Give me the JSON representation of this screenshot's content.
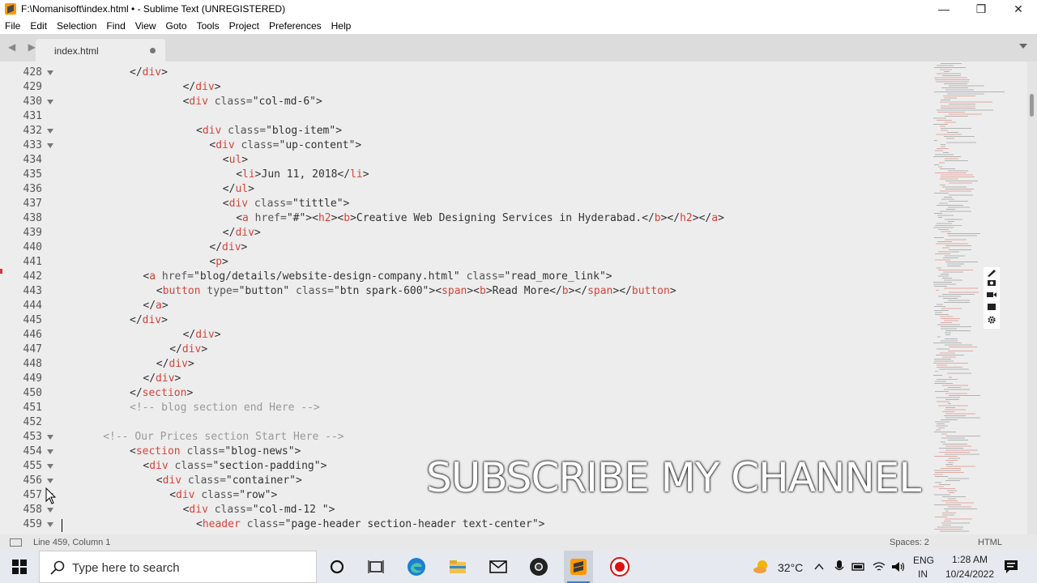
{
  "window": {
    "title": "F:\\Nomanisoft\\index.html • - Sublime Text (UNREGISTERED)",
    "minimize": "—",
    "maximize": "❐",
    "close": "✕"
  },
  "menu": [
    "File",
    "Edit",
    "Selection",
    "Find",
    "View",
    "Goto",
    "Tools",
    "Project",
    "Preferences",
    "Help"
  ],
  "tab": {
    "label": "index.html",
    "modified": true
  },
  "nav_arrows": "◀ ▶",
  "editor": {
    "lines": [
      {
        "n": "428",
        "fold": true,
        "indent": 10,
        "tokens": [
          [
            "p",
            "</"
          ],
          [
            "t",
            "div"
          ],
          [
            "p",
            ">"
          ]
        ]
      },
      {
        "n": "429",
        "fold": false,
        "indent": 18,
        "tokens": [
          [
            "p",
            "</"
          ],
          [
            "t",
            "div"
          ],
          [
            "p",
            ">"
          ]
        ]
      },
      {
        "n": "430",
        "fold": true,
        "indent": 18,
        "tokens": [
          [
            "p",
            "<"
          ],
          [
            "t",
            "div"
          ],
          [
            "a",
            " class="
          ],
          [
            "v",
            "\"col-md-6\""
          ],
          [
            "p",
            ">"
          ]
        ]
      },
      {
        "n": "431",
        "fold": false,
        "indent": 0,
        "tokens": []
      },
      {
        "n": "432",
        "fold": true,
        "indent": 20,
        "tokens": [
          [
            "p",
            "<"
          ],
          [
            "t",
            "div"
          ],
          [
            "a",
            " class="
          ],
          [
            "v",
            "\"blog-item\""
          ],
          [
            "p",
            ">"
          ]
        ]
      },
      {
        "n": "433",
        "fold": true,
        "indent": 22,
        "tokens": [
          [
            "p",
            "<"
          ],
          [
            "t",
            "div"
          ],
          [
            "a",
            " class="
          ],
          [
            "v",
            "\"up-content\""
          ],
          [
            "p",
            ">"
          ]
        ]
      },
      {
        "n": "434",
        "fold": false,
        "indent": 24,
        "tokens": [
          [
            "p",
            "<"
          ],
          [
            "t",
            "ul"
          ],
          [
            "p",
            ">"
          ]
        ]
      },
      {
        "n": "435",
        "fold": false,
        "indent": 26,
        "tokens": [
          [
            "p",
            "<"
          ],
          [
            "t",
            "li"
          ],
          [
            "p",
            ">Jun 11, 2018</"
          ],
          [
            "t",
            "li"
          ],
          [
            "p",
            ">"
          ]
        ]
      },
      {
        "n": "436",
        "fold": false,
        "indent": 24,
        "tokens": [
          [
            "p",
            "</"
          ],
          [
            "t",
            "ul"
          ],
          [
            "p",
            ">"
          ]
        ]
      },
      {
        "n": "437",
        "fold": false,
        "indent": 24,
        "tokens": [
          [
            "p",
            "<"
          ],
          [
            "t",
            "div"
          ],
          [
            "a",
            " class="
          ],
          [
            "v",
            "\"tittle\""
          ],
          [
            "p",
            ">"
          ]
        ]
      },
      {
        "n": "438",
        "fold": false,
        "indent": 26,
        "tokens": [
          [
            "p",
            "<"
          ],
          [
            "t",
            "a"
          ],
          [
            "a",
            " href="
          ],
          [
            "v",
            "\"#\""
          ],
          [
            "p",
            "><"
          ],
          [
            "t",
            "h2"
          ],
          [
            "p",
            "><"
          ],
          [
            "t",
            "b"
          ],
          [
            "p",
            ">Creative Web Designing Services in Hyderabad.</"
          ],
          [
            "t",
            "b"
          ],
          [
            "p",
            "></"
          ],
          [
            "t",
            "h2"
          ],
          [
            "p",
            "></"
          ],
          [
            "t",
            "a"
          ],
          [
            "p",
            ">"
          ]
        ]
      },
      {
        "n": "439",
        "fold": false,
        "indent": 24,
        "tokens": [
          [
            "p",
            "</"
          ],
          [
            "t",
            "div"
          ],
          [
            "p",
            ">"
          ]
        ]
      },
      {
        "n": "440",
        "fold": false,
        "indent": 22,
        "tokens": [
          [
            "p",
            "</"
          ],
          [
            "t",
            "div"
          ],
          [
            "p",
            ">"
          ]
        ]
      },
      {
        "n": "441",
        "fold": false,
        "indent": 22,
        "tokens": [
          [
            "p",
            "<"
          ],
          [
            "t",
            "p"
          ],
          [
            "p",
            ">"
          ]
        ]
      },
      {
        "n": "442",
        "fold": false,
        "indent": 12,
        "tokens": [
          [
            "p",
            "<"
          ],
          [
            "t",
            "a"
          ],
          [
            "a",
            " href="
          ],
          [
            "v",
            "\"blog/details/website-design-company.html\""
          ],
          [
            "a",
            " class="
          ],
          [
            "v",
            "\"read_more_link\""
          ],
          [
            "p",
            ">"
          ]
        ]
      },
      {
        "n": "443",
        "fold": false,
        "indent": 14,
        "tokens": [
          [
            "p",
            "<"
          ],
          [
            "t",
            "button"
          ],
          [
            "a",
            " type="
          ],
          [
            "v",
            "\"button\""
          ],
          [
            "a",
            " class="
          ],
          [
            "v",
            "\"btn spark-600\""
          ],
          [
            "p",
            "><"
          ],
          [
            "t",
            "span"
          ],
          [
            "p",
            "><"
          ],
          [
            "t",
            "b"
          ],
          [
            "p",
            ">Read More</"
          ],
          [
            "t",
            "b"
          ],
          [
            "p",
            "></"
          ],
          [
            "t",
            "span"
          ],
          [
            "p",
            "></"
          ],
          [
            "t",
            "button"
          ],
          [
            "p",
            ">"
          ]
        ]
      },
      {
        "n": "444",
        "fold": false,
        "indent": 12,
        "tokens": [
          [
            "p",
            "</"
          ],
          [
            "t",
            "a"
          ],
          [
            "p",
            ">"
          ]
        ]
      },
      {
        "n": "445",
        "fold": false,
        "indent": 10,
        "tokens": [
          [
            "p",
            "</"
          ],
          [
            "t",
            "div"
          ],
          [
            "p",
            ">"
          ]
        ]
      },
      {
        "n": "446",
        "fold": false,
        "indent": 18,
        "tokens": [
          [
            "p",
            "</"
          ],
          [
            "t",
            "div"
          ],
          [
            "p",
            ">"
          ]
        ]
      },
      {
        "n": "447",
        "fold": false,
        "indent": 16,
        "tokens": [
          [
            "p",
            "</"
          ],
          [
            "t",
            "div"
          ],
          [
            "p",
            ">"
          ]
        ]
      },
      {
        "n": "448",
        "fold": false,
        "indent": 14,
        "tokens": [
          [
            "p",
            "</"
          ],
          [
            "t",
            "div"
          ],
          [
            "p",
            ">"
          ]
        ]
      },
      {
        "n": "449",
        "fold": false,
        "indent": 12,
        "tokens": [
          [
            "p",
            "</"
          ],
          [
            "t",
            "div"
          ],
          [
            "p",
            ">"
          ]
        ]
      },
      {
        "n": "450",
        "fold": false,
        "indent": 10,
        "tokens": [
          [
            "p",
            "</"
          ],
          [
            "t",
            "section"
          ],
          [
            "p",
            ">"
          ]
        ]
      },
      {
        "n": "451",
        "fold": false,
        "indent": 10,
        "tokens": [
          [
            "c",
            "<!-- blog section end Here -->"
          ]
        ]
      },
      {
        "n": "452",
        "fold": false,
        "indent": 0,
        "tokens": []
      },
      {
        "n": "453",
        "fold": true,
        "indent": 6,
        "tokens": [
          [
            "c",
            "<!-- Our Prices section Start Here -->"
          ]
        ]
      },
      {
        "n": "454",
        "fold": true,
        "indent": 10,
        "tokens": [
          [
            "p",
            "<"
          ],
          [
            "t",
            "section"
          ],
          [
            "a",
            " class="
          ],
          [
            "v",
            "\"blog-news\""
          ],
          [
            "p",
            ">"
          ]
        ]
      },
      {
        "n": "455",
        "fold": true,
        "indent": 12,
        "tokens": [
          [
            "p",
            "<"
          ],
          [
            "t",
            "div"
          ],
          [
            "a",
            " class="
          ],
          [
            "v",
            "\"section-padding\""
          ],
          [
            "p",
            ">"
          ]
        ]
      },
      {
        "n": "456",
        "fold": true,
        "indent": 14,
        "tokens": [
          [
            "p",
            "<"
          ],
          [
            "t",
            "div"
          ],
          [
            "a",
            " class="
          ],
          [
            "v",
            "\"container\""
          ],
          [
            "p",
            ">"
          ]
        ]
      },
      {
        "n": "457",
        "fold": true,
        "indent": 16,
        "tokens": [
          [
            "p",
            "<"
          ],
          [
            "t",
            "div"
          ],
          [
            "a",
            " class="
          ],
          [
            "v",
            "\"row\""
          ],
          [
            "p",
            ">"
          ]
        ]
      },
      {
        "n": "458",
        "fold": true,
        "indent": 18,
        "tokens": [
          [
            "p",
            "<"
          ],
          [
            "t",
            "div"
          ],
          [
            "a",
            " class="
          ],
          [
            "v",
            "\"col-md-12 \""
          ],
          [
            "p",
            ">"
          ]
        ]
      },
      {
        "n": "459",
        "fold": true,
        "indent": 20,
        "tokens": [
          [
            "p",
            "<"
          ],
          [
            "t",
            "header"
          ],
          [
            "a",
            " class="
          ],
          [
            "v",
            "\"page-header section-header text-center\""
          ],
          [
            "p",
            ">"
          ]
        ]
      }
    ]
  },
  "overlay": {
    "text": "SUBSCRIBE MY CHANNEL"
  },
  "status": {
    "position": "Line 459, Column 1",
    "spaces": "Spaces: 2",
    "syntax": "HTML"
  },
  "taskbar": {
    "search_placeholder": "Type here to search",
    "temperature": "32°C",
    "lang_top": "ENG",
    "lang_bottom": "IN",
    "time": "1:28 AM",
    "date": "10/24/2022"
  },
  "colors": {
    "tag": "#d6443a",
    "comment": "#999999",
    "editor_bg": "#ededed",
    "sublime_orange": "#ff9800"
  }
}
